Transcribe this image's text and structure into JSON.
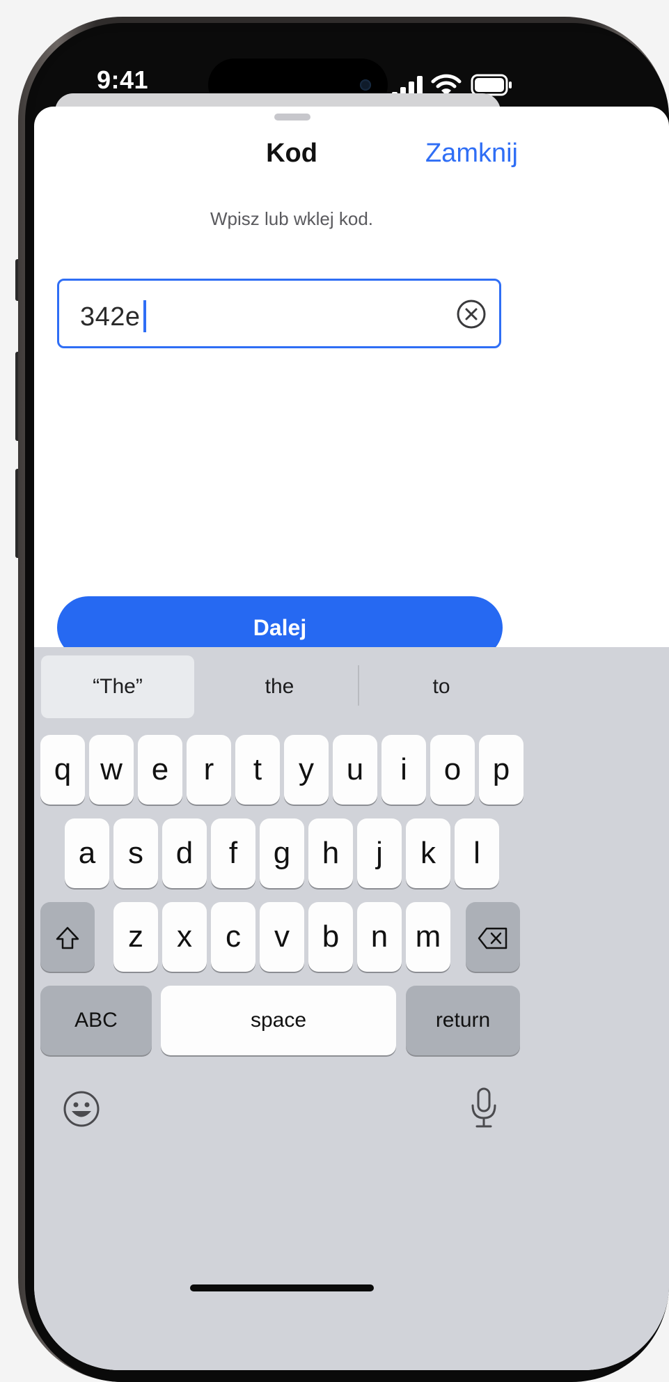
{
  "status_bar": {
    "time": "9:41",
    "icons": [
      "cellular-signal-icon",
      "wifi-icon",
      "battery-icon"
    ]
  },
  "sheet": {
    "title": "Kod",
    "close_label": "Zamknij",
    "instructions": "Wpisz lub wklej kod.",
    "code_input": {
      "value": "342e",
      "clear_icon": "clear-circle-x-icon"
    },
    "continue_label": "Dalej"
  },
  "keyboard": {
    "predictions": [
      "“The”",
      "the",
      "to"
    ],
    "row1": [
      "q",
      "w",
      "e",
      "r",
      "t",
      "y",
      "u",
      "i",
      "o",
      "p"
    ],
    "row2": [
      "a",
      "s",
      "d",
      "f",
      "g",
      "h",
      "j",
      "k",
      "l"
    ],
    "row3": [
      "z",
      "x",
      "c",
      "v",
      "b",
      "n",
      "m"
    ],
    "abc_label": "ABC",
    "space_label": "space",
    "return_label": "return",
    "icons": [
      "shift-icon",
      "backspace-icon",
      "emoji-icon",
      "microphone-icon"
    ]
  },
  "colors": {
    "accent": "#2f6ef5",
    "button": "#2669f2",
    "keyboard_bg": "#d1d3d9"
  }
}
